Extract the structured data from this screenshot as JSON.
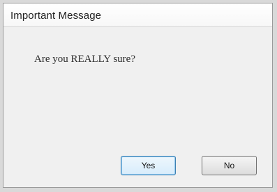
{
  "dialog": {
    "title": "Important Message",
    "message": "Are you REALLY sure?",
    "buttons": {
      "yes_label": "Yes",
      "no_label": "No"
    }
  }
}
